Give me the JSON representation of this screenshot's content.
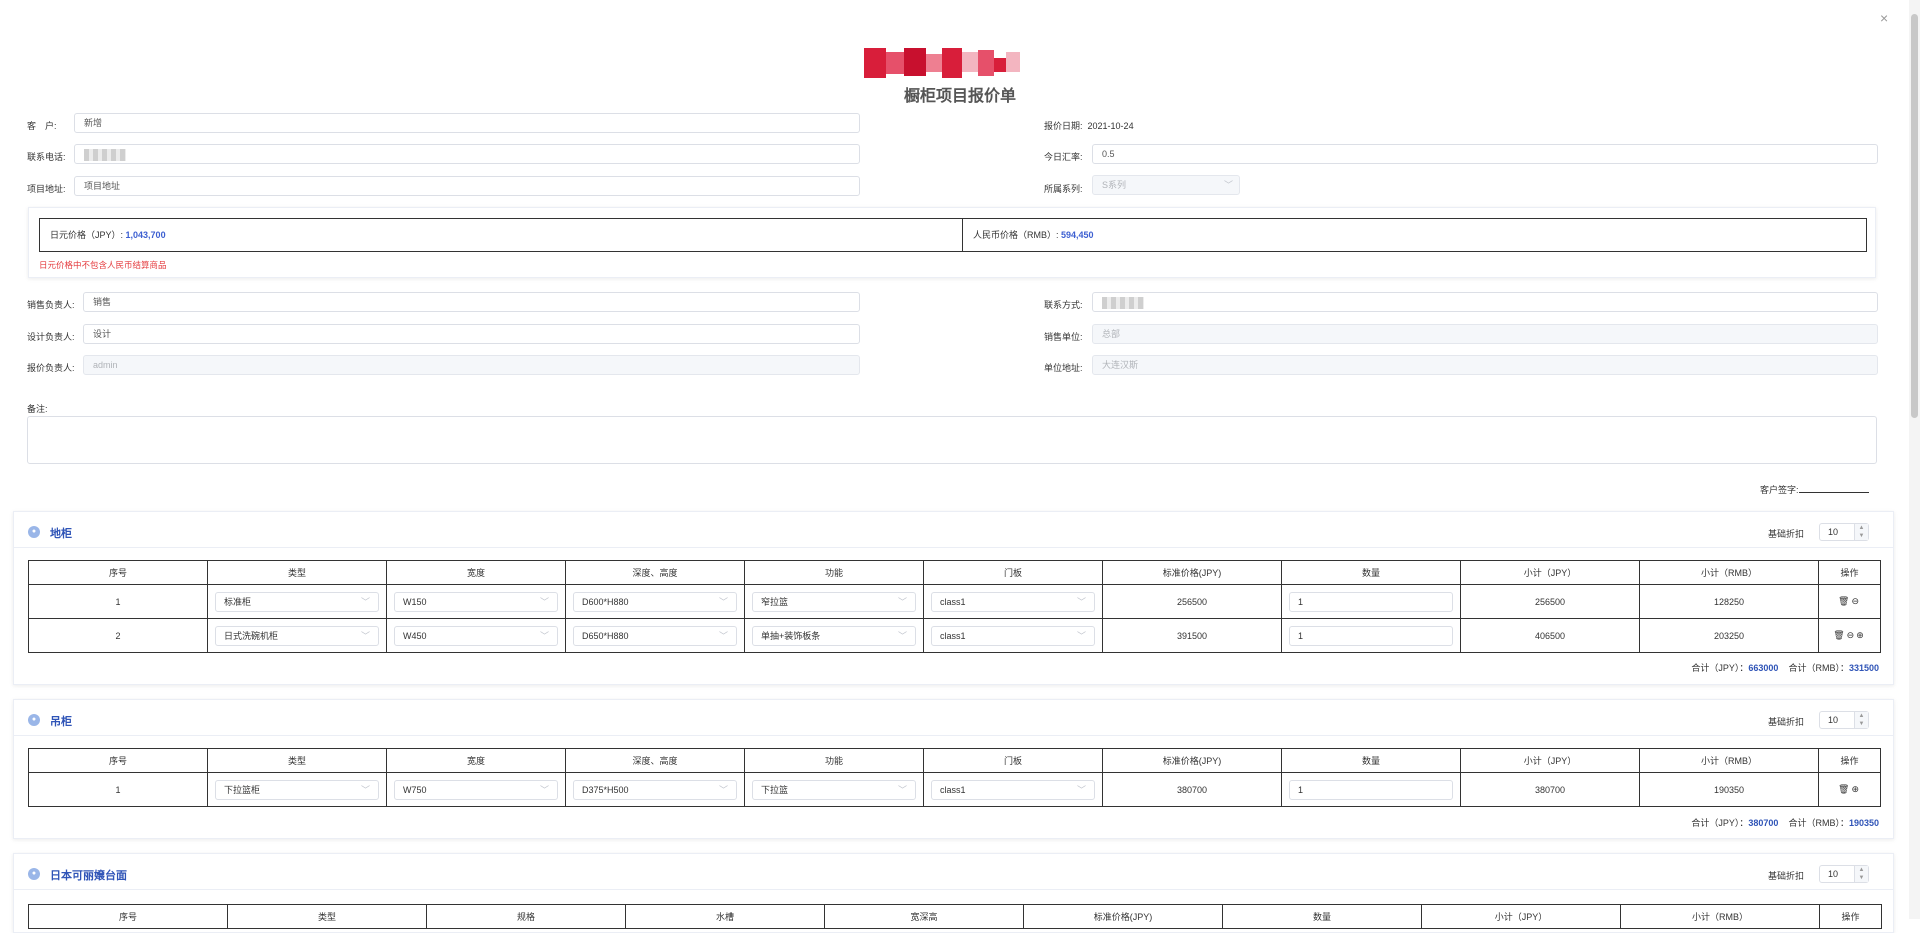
{
  "window": {
    "close_label": "×"
  },
  "doc": {
    "title": "橱柜项目报价单"
  },
  "form": {
    "customer_label": "客　户:",
    "customer_value": "新增",
    "phone_label": "联系电话:",
    "address_label": "项目地址:",
    "address_placeholder": "项目地址",
    "quote_date_label": "报价日期:",
    "quote_date_value": "2021-10-24",
    "rate_label": "今日汇率:",
    "rate_value": "0.5",
    "series_label": "所属系列:",
    "series_value": "S系列"
  },
  "price": {
    "jpy_label": "日元价格（JPY）:",
    "jpy_value": "1,043,700",
    "rmb_label": "人民币价格（RMB）:",
    "rmb_value": "594,450",
    "note": "日元价格中不包含人民币结算商品"
  },
  "staff": {
    "sales_label": "销售负责人:",
    "sales_value": "销售",
    "design_label": "设计负责人:",
    "design_value": "设计",
    "quote_label": "报价负责人:",
    "quote_value": "admin",
    "contact_label": "联系方式:",
    "unit_label": "销售单位:",
    "unit_value": "总部",
    "unit_addr_label": "单位地址:",
    "unit_addr_value": "大连汉斯"
  },
  "remark": {
    "label": "备注:"
  },
  "signature": {
    "label": "客户签字:"
  },
  "common": {
    "discount_label": "基础折扣",
    "discount_value": "10",
    "total_jpy_label": "合计（JPY）：",
    "total_rmb_label": "合计（RMB）："
  },
  "columns": [
    "序号",
    "类型",
    "宽度",
    "深度、高度",
    "功能",
    "门板",
    "标准价格(JPY)",
    "数量",
    "小计（JPY）",
    "小计（RMB）",
    "操作"
  ],
  "columns_counter": [
    "序号",
    "类型",
    "规格",
    "水槽",
    "宽深高",
    "标准价格(JPY)",
    "数量",
    "小计（JPY）",
    "小计（RMB）",
    "操作"
  ],
  "sections": [
    {
      "title": "地柜",
      "rows": [
        {
          "no": "1",
          "type": "标准柜",
          "width": "W150",
          "depth": "D600*H880",
          "func": "窄拉篮",
          "door": "class1",
          "price": "256500",
          "qty": "1",
          "sub_jpy": "256500",
          "sub_rmb": "128250"
        },
        {
          "no": "2",
          "type": "日式洗碗机柜",
          "width": "W450",
          "depth": "D650*H880",
          "func": "单抽+装饰板条",
          "door": "class1",
          "price": "391500",
          "qty": "1",
          "sub_jpy": "406500",
          "sub_rmb": "203250"
        }
      ],
      "total_jpy": "663000",
      "total_rmb": "331500"
    },
    {
      "title": "吊柜",
      "rows": [
        {
          "no": "1",
          "type": "下拉篮柜",
          "width": "W750",
          "depth": "D375*H500",
          "func": "下拉篮",
          "door": "class1",
          "price": "380700",
          "qty": "1",
          "sub_jpy": "380700",
          "sub_rmb": "190350"
        }
      ],
      "total_jpy": "380700",
      "total_rmb": "190350"
    },
    {
      "title": "日本可丽嬢台面"
    }
  ]
}
